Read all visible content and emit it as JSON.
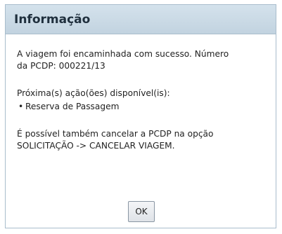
{
  "dialog": {
    "title": "Informação",
    "message": "A viagem foi encaminhada com sucesso. Número\nda PCDP: 000221/13",
    "actions_heading": "Próxima(s) ação(ões) disponível(is):",
    "actions": [
      {
        "label": "Reserva de Passagem"
      }
    ],
    "cancel_note": "É possível também cancelar a PCDP na opção\nSOLICITAÇÃO -> CANCELAR VIAGEM.",
    "ok_label": "OK"
  },
  "colors": {
    "header_background": "#c8d8e4",
    "border": "#a9bdcc",
    "text": "#222222"
  }
}
